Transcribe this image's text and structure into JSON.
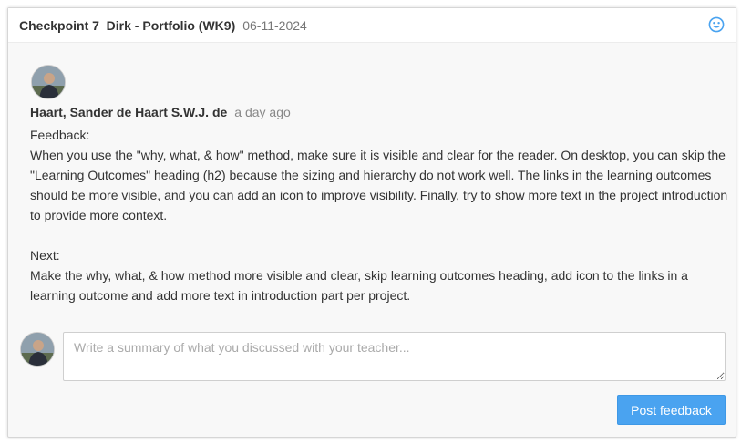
{
  "header": {
    "title": "Checkpoint 7  Dirk - Portfolio (WK9)",
    "date": "06-11-2024",
    "icon": "smiley-icon"
  },
  "comment": {
    "author": "Haart, Sander de Haart S.W.J. de",
    "time": "a day ago",
    "feedback_label": "Feedback:",
    "feedback_text": "When you use the \"why, what, & how\" method, make sure it is visible and clear for the reader. On desktop, you can skip the \"Learning Outcomes\" heading (h2) because the sizing and hierarchy do not work well. The links in the learning outcomes should be more visible, and you can add an icon to improve visibility. Finally, try to show more text in the project introduction to provide more context.",
    "next_label": "Next:",
    "next_text": "Make the why, what, & how method more visible and clear, skip learning outcomes heading, add icon to the links in a learning outcome and add more text in introduction part per project."
  },
  "reply": {
    "placeholder": "Write a summary of what you discussed with your teacher...",
    "value": ""
  },
  "post_button_label": "Post feedback",
  "colors": {
    "accent": "#4aa3f0",
    "smiley": "#4aa3f0"
  }
}
